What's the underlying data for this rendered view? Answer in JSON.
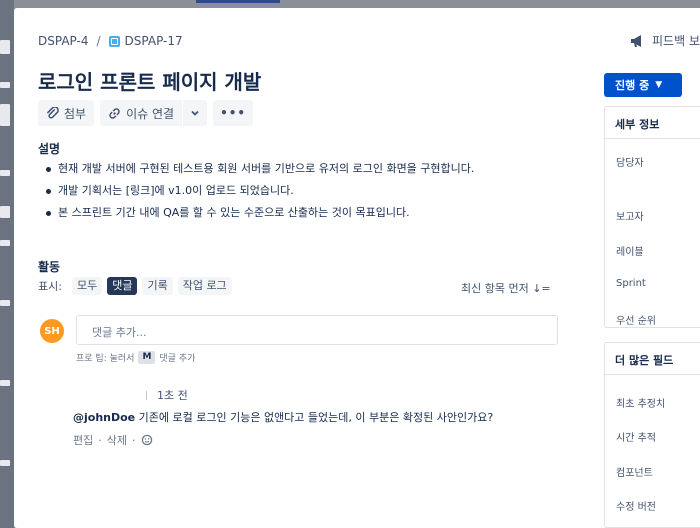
{
  "breadcrumb": {
    "parent": "DSPAP-4",
    "separator": "/",
    "current": "DSPAP-17"
  },
  "feedback_label": "피드백 보",
  "title": "로그인 프론트 페이지 개발",
  "toolbar": {
    "attach": "첨부",
    "link_issue": "이슈 연결",
    "more": "•••"
  },
  "description": {
    "label": "설명",
    "items": [
      "현재 개발 서버에 구현된 테스트용 회원 서버를 기반으로 유저의 로그인 화면을 구현합니다.",
      "개발 기획서는 [링크]에 v1.0이 업로드 되었습니다.",
      "본 스프린트 기간 내에 QA를 할 수 있는 수준으로 산출하는 것이 목표입니다."
    ]
  },
  "activity": {
    "label": "활동",
    "show_label": "표시:",
    "filters": [
      "모두",
      "댓글",
      "기록",
      "작업 로그"
    ],
    "active_filter": "댓글",
    "sort": "최신 항목 먼저 ↓="
  },
  "new_comment": {
    "avatar": "SH",
    "placeholder": "댓글 추가...",
    "tip_prefix": "프로 팁: 눌러서",
    "tip_key": "M",
    "tip_suffix": "댓글 추가"
  },
  "comment": {
    "time": "1초 전",
    "mention": "@johnDoe",
    "text": " 기존에 로컬 로그인 기능은 없앤다고 들었는데, 이 부분은 확정된 사안인가요?",
    "edit": "편집",
    "delete": "삭제",
    "dot": "·"
  },
  "status": {
    "label": "진행 중",
    "chevron": "▼"
  },
  "details": {
    "header": "세부 정보",
    "fields": [
      "담당자",
      "보고자",
      "레이블",
      "Sprint",
      "우선 순위"
    ]
  },
  "more_fields": {
    "header": "더 많은 필드",
    "fields": [
      "최초 추정치",
      "시간 추적",
      "컴포넌트",
      "수정 버전"
    ]
  },
  "colors": {
    "primary": "#0052cc",
    "avatar": "#ff991f",
    "active_chip": "#253858",
    "issue_type": "#4bade8"
  }
}
